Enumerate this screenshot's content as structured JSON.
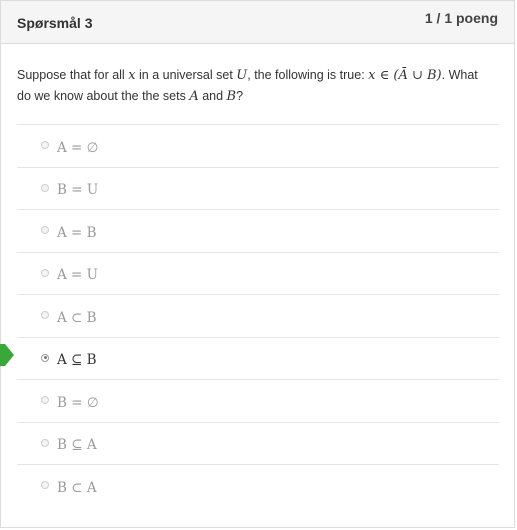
{
  "header": {
    "title": "Spørsmål 3",
    "score": "1 / 1 poeng"
  },
  "question": {
    "part1": "Suppose that for all ",
    "var_x": "x",
    "part2": " in a universal set ",
    "var_U": "U",
    "part3": ", the following is true: ",
    "formula": "x ∈ (Ā ∪ B)",
    "part4": ". What do we know about the  the sets ",
    "var_A": "A",
    "part5": " and ",
    "var_B": "B",
    "part6": "?"
  },
  "options": [
    {
      "label": "A = ∅",
      "selected": false
    },
    {
      "label": "B = U",
      "selected": false
    },
    {
      "label": "A = B",
      "selected": false
    },
    {
      "label": "A = U",
      "selected": false
    },
    {
      "label": "A ⊂ B",
      "selected": false
    },
    {
      "label": "A ⊆ B",
      "selected": true
    },
    {
      "label": "B = ∅",
      "selected": false
    },
    {
      "label": "B ⊆ A",
      "selected": false
    },
    {
      "label": "B ⊂ A",
      "selected": false
    }
  ],
  "colors": {
    "correct_marker": "#3aa73a",
    "header_bg": "#f5f5f5"
  },
  "icons": {
    "correct_marker": "correct-answer-arrow-icon"
  }
}
